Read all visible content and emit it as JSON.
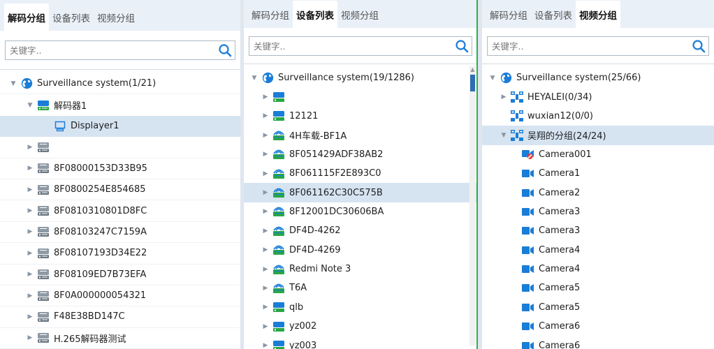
{
  "colors": {
    "accent": "#1a7dd7",
    "tab_bar": "#e9f0f8",
    "selected_row": "#d6e4f2",
    "green_divider": "#28b14c"
  },
  "panels": [
    {
      "id": "p1",
      "tabs": [
        {
          "label": "解码分组",
          "active": true
        },
        {
          "label": "设备列表",
          "active": false
        },
        {
          "label": "视频分组",
          "active": false
        }
      ],
      "search": {
        "placeholder": "关键字.."
      },
      "rows": [
        {
          "label": "Surveillance system(1/21)",
          "level": 0,
          "arrow": "expanded",
          "icon": "globe-icon",
          "sep": true
        },
        {
          "label": "解码器1",
          "level": 1,
          "arrow": "expanded",
          "icon": "decoder-online-icon"
        },
        {
          "label": "Displayer1",
          "level": 2,
          "arrow": "none",
          "icon": "display-icon",
          "selected": true
        },
        {
          "label": "",
          "level": 1,
          "arrow": "collapsed",
          "icon": "decoder-offline-icon",
          "sep": true
        },
        {
          "label": "8F08000153D33B95",
          "level": 1,
          "arrow": "collapsed",
          "icon": "decoder-offline-icon",
          "sep": true
        },
        {
          "label": "8F0800254E854685",
          "level": 1,
          "arrow": "collapsed",
          "icon": "decoder-offline-icon",
          "sep": true
        },
        {
          "label": "8F0810310801D8FC",
          "level": 1,
          "arrow": "collapsed",
          "icon": "decoder-offline-icon",
          "sep": true
        },
        {
          "label": "8F08103247C7159A",
          "level": 1,
          "arrow": "collapsed",
          "icon": "decoder-offline-icon",
          "sep": true
        },
        {
          "label": "8F08107193D34E22",
          "level": 1,
          "arrow": "collapsed",
          "icon": "decoder-offline-icon",
          "sep": true
        },
        {
          "label": "8F08109ED7B73EFA",
          "level": 1,
          "arrow": "collapsed",
          "icon": "decoder-offline-icon",
          "sep": true
        },
        {
          "label": "8F0A000000054321",
          "level": 1,
          "arrow": "collapsed",
          "icon": "decoder-offline-icon",
          "sep": true
        },
        {
          "label": "F48E38BD147C",
          "level": 1,
          "arrow": "collapsed",
          "icon": "decoder-offline-icon",
          "sep": true
        },
        {
          "label": "H.265解码器测试",
          "level": 1,
          "arrow": "collapsed",
          "icon": "decoder-offline-icon",
          "sep": true
        }
      ]
    },
    {
      "id": "p2",
      "tabs": [
        {
          "label": "解码分组",
          "active": false
        },
        {
          "label": "设备列表",
          "active": true
        },
        {
          "label": "视频分组",
          "active": false
        }
      ],
      "search": {
        "placeholder": "关键字.."
      },
      "rows": [
        {
          "label": "Surveillance system(19/1286)",
          "level": 0,
          "arrow": "expanded",
          "icon": "globe-icon"
        },
        {
          "label": "",
          "level": 1,
          "arrow": "collapsed",
          "icon": "nvr-online-icon"
        },
        {
          "label": "12121",
          "level": 1,
          "arrow": "collapsed",
          "icon": "nvr-online-icon"
        },
        {
          "label": "4H车载-BF1A",
          "level": 1,
          "arrow": "collapsed",
          "icon": "wireless-device-icon"
        },
        {
          "label": "8F051429ADF38AB2",
          "level": 1,
          "arrow": "collapsed",
          "icon": "wireless-device-icon"
        },
        {
          "label": "8F061115F2E893C0",
          "level": 1,
          "arrow": "collapsed",
          "icon": "wireless-device-icon"
        },
        {
          "label": "8F061162C30C575B",
          "level": 1,
          "arrow": "collapsed",
          "icon": "wireless-device-icon",
          "selected": true
        },
        {
          "label": "8F12001DC30606BA",
          "level": 1,
          "arrow": "collapsed",
          "icon": "wireless-device-icon"
        },
        {
          "label": "DF4D-4262",
          "level": 1,
          "arrow": "collapsed",
          "icon": "wireless-device-icon"
        },
        {
          "label": "DF4D-4269",
          "level": 1,
          "arrow": "collapsed",
          "icon": "wireless-device-icon"
        },
        {
          "label": "Redmi Note 3",
          "level": 1,
          "arrow": "collapsed",
          "icon": "wireless-device-icon"
        },
        {
          "label": "T6A",
          "level": 1,
          "arrow": "collapsed",
          "icon": "wireless-device-icon"
        },
        {
          "label": "qlb",
          "level": 1,
          "arrow": "collapsed",
          "icon": "nvr-online-icon"
        },
        {
          "label": "yz002",
          "level": 1,
          "arrow": "collapsed",
          "icon": "nvr-online-icon"
        },
        {
          "label": "yz003",
          "level": 1,
          "arrow": "collapsed",
          "icon": "nvr-online-icon"
        }
      ]
    },
    {
      "id": "p3",
      "tabs": [
        {
          "label": "解码分组",
          "active": false
        },
        {
          "label": "设备列表",
          "active": false
        },
        {
          "label": "视频分组",
          "active": true
        }
      ],
      "search": {
        "placeholder": "关键字.."
      },
      "rows": [
        {
          "label": "Surveillance system(25/66)",
          "level": 0,
          "arrow": "expanded",
          "icon": "globe-icon"
        },
        {
          "label": "HEYALEI(0/34)",
          "level": 1,
          "arrow": "collapsed",
          "icon": "group-icon"
        },
        {
          "label": "wuxian12(0/0)",
          "level": 1,
          "arrow": "none",
          "icon": "group-icon"
        },
        {
          "label": "吴翔的分组(24/24)",
          "level": 1,
          "arrow": "expanded",
          "icon": "group-icon",
          "selected": true
        },
        {
          "label": "Camera001",
          "level": 2,
          "arrow": "none",
          "icon": "camera-offline-icon"
        },
        {
          "label": "Camera1",
          "level": 2,
          "arrow": "none",
          "icon": "camera-icon"
        },
        {
          "label": "Camera2",
          "level": 2,
          "arrow": "none",
          "icon": "camera-icon"
        },
        {
          "label": "Camera3",
          "level": 2,
          "arrow": "none",
          "icon": "camera-icon"
        },
        {
          "label": "Camera3",
          "level": 2,
          "arrow": "none",
          "icon": "camera-icon"
        },
        {
          "label": "Camera4",
          "level": 2,
          "arrow": "none",
          "icon": "camera-icon"
        },
        {
          "label": "Camera4",
          "level": 2,
          "arrow": "none",
          "icon": "camera-icon"
        },
        {
          "label": "Camera5",
          "level": 2,
          "arrow": "none",
          "icon": "camera-icon"
        },
        {
          "label": "Camera5",
          "level": 2,
          "arrow": "none",
          "icon": "camera-icon"
        },
        {
          "label": "Camera6",
          "level": 2,
          "arrow": "none",
          "icon": "camera-icon"
        },
        {
          "label": "Camera6",
          "level": 2,
          "arrow": "none",
          "icon": "camera-icon"
        }
      ]
    }
  ]
}
